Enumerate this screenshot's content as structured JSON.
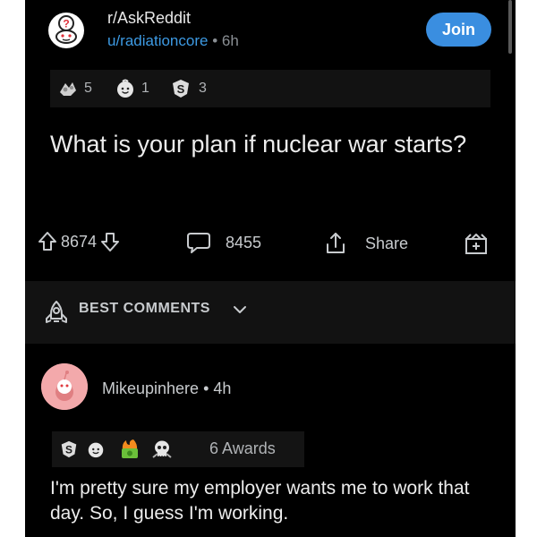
{
  "post": {
    "subreddit": "r/AskReddit",
    "author": "u/radiationcore",
    "separator": "•",
    "age": "6h",
    "join_label": "Join",
    "awards": [
      {
        "icon": "silver-award-icon",
        "count": "5"
      },
      {
        "icon": "wholesome-award-icon",
        "count": "1"
      },
      {
        "icon": "s-award-icon",
        "count": "3"
      }
    ],
    "title": "What is your plan if nuclear war starts?",
    "upvotes": "8674",
    "comments": "8455",
    "share_label": "Share"
  },
  "sort": {
    "label": "BEST COMMENTS"
  },
  "comment": {
    "username": "Mikeupinhere",
    "separator": "•",
    "age": "4h",
    "awards_label": "6 Awards",
    "body": "I'm pretty sure my employer wants me to work that day. So, I guess I'm working."
  },
  "colors": {
    "background": "#000000",
    "accent": "#3a8ee0",
    "username_link": "#3d9ae3",
    "text": "#ececec",
    "muted": "#8a8f94"
  }
}
